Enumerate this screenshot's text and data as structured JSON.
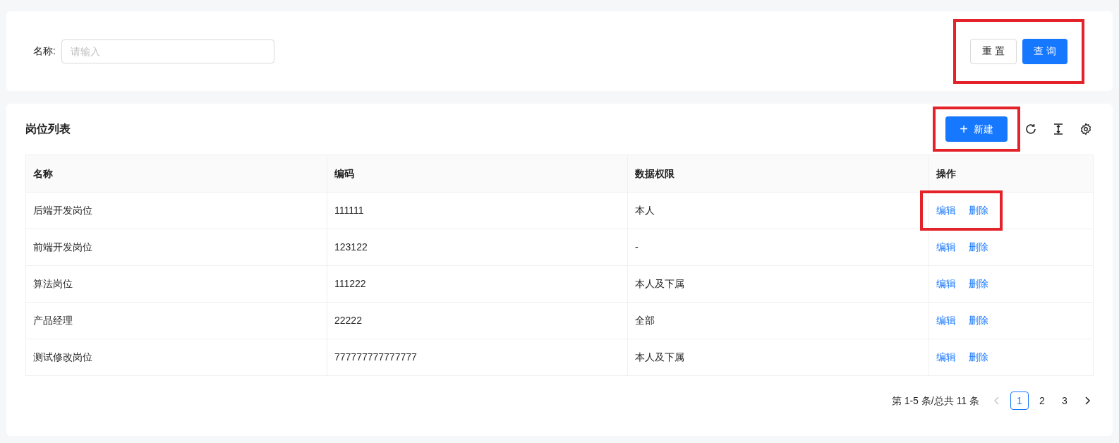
{
  "search_form": {
    "field_label": "名称:",
    "field": {
      "placeholder": "请输入"
    },
    "buttons_highlighted": true,
    "reset_button": "重 置",
    "query_button": "查 询"
  },
  "table_card": {
    "title": "岗位列表",
    "new_button": {
      "icon": "+",
      "label": "新建",
      "highlighted": true
    },
    "columns": [
      "名称",
      "编码",
      "数据权限",
      "操作"
    ],
    "rows": [
      {
        "name": "后端开发岗位",
        "code": "111111",
        "data_scope": "本人",
        "actions": [
          "编辑",
          "删除"
        ],
        "actions_highlighted": true
      },
      {
        "name": "前端开发岗位",
        "code": "123122",
        "data_scope": "-",
        "actions": [
          "编辑",
          "删除"
        ],
        "actions_highlighted": false
      },
      {
        "name": "算法岗位",
        "code": "111222",
        "data_scope": "本人及下属",
        "actions": [
          "编辑",
          "删除"
        ],
        "actions_highlighted": false
      },
      {
        "name": "产品经理",
        "code": "22222",
        "data_scope": "全部",
        "actions": [
          "编辑",
          "删除"
        ],
        "actions_highlighted": false
      },
      {
        "name": "测试修改岗位",
        "code": "777777777777777",
        "data_scope": "本人及下属",
        "actions": [
          "编辑",
          "删除"
        ],
        "actions_highlighted": false
      }
    ],
    "pagination": {
      "summary": "第 1-5 条/总共 11 条",
      "prev_disabled": true,
      "next_disabled": false,
      "pages": [
        {
          "label": "1",
          "selected": true
        },
        {
          "label": "2",
          "selected": false
        },
        {
          "label": "3",
          "selected": false
        }
      ]
    }
  }
}
